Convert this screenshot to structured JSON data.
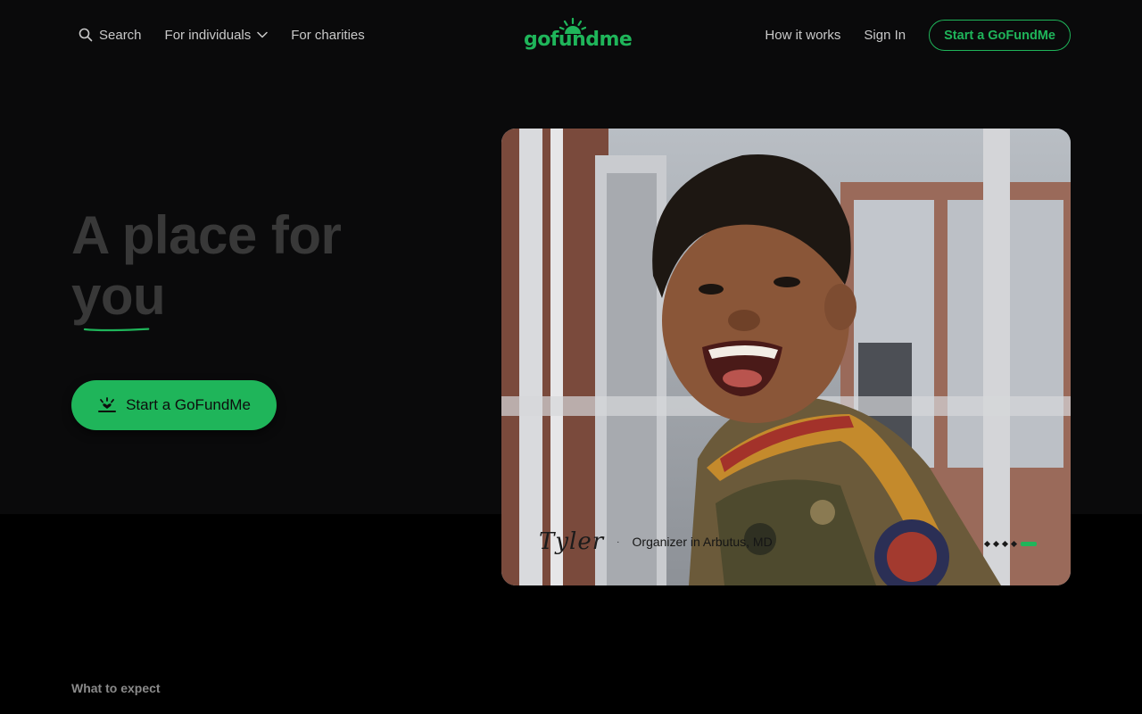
{
  "nav": {
    "search_label": "Search",
    "individuals_label": "For individuals",
    "charities_label": "For charities",
    "logo_text": "gofundme",
    "how_it_works": "How it works",
    "sign_in": "Sign In",
    "start_button": "Start a GoFundMe"
  },
  "hero": {
    "title_line1": "A place for",
    "title_line2": "you",
    "cta_label": "Start a GoFundMe"
  },
  "photo": {
    "signature": "Tyler",
    "separator": "·",
    "organizer_caption": "Organizer in Arbutus, MD",
    "slides": {
      "count": 5,
      "active": 5
    }
  },
  "section": {
    "label": "What to expect"
  },
  "colors": {
    "brand_green": "#1fb55a",
    "background": "#0a0a0b"
  },
  "icons": [
    "search-icon",
    "chevron-down-icon",
    "logo-sun-icon",
    "heart-hand-icon"
  ]
}
